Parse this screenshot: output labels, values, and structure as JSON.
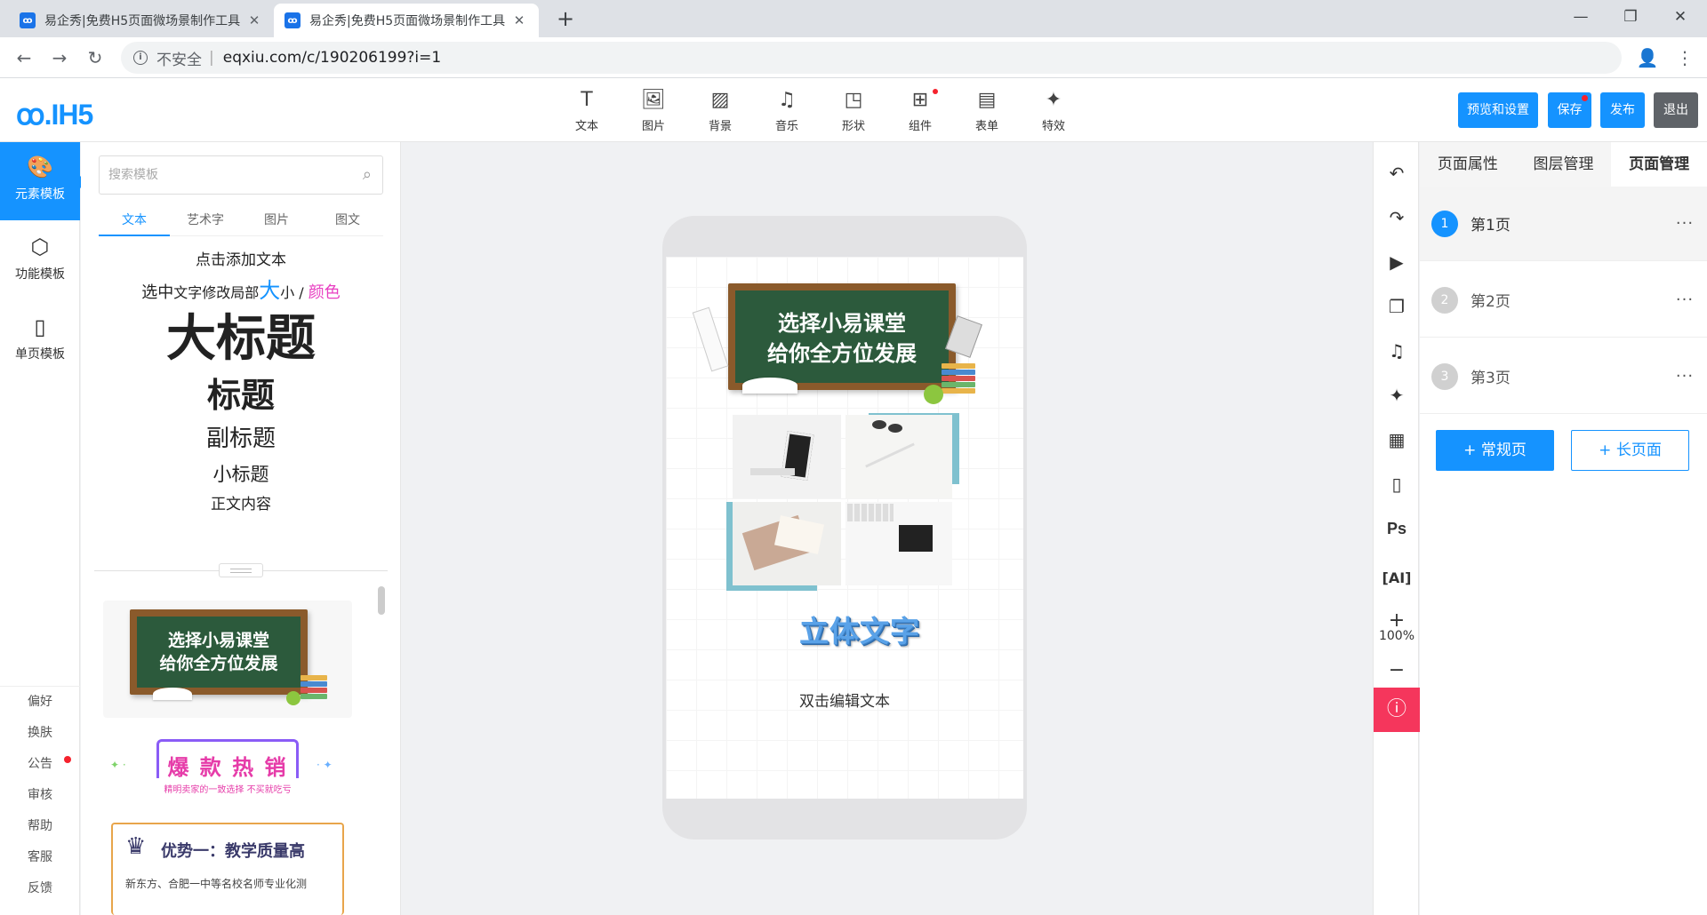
{
  "browser": {
    "tabs": [
      {
        "title": "易企秀|免费H5页面微场景制作工具"
      },
      {
        "title": "易企秀|免费H5页面微场景制作工具"
      }
    ],
    "address": {
      "security_text": "不安全",
      "url": "eqxiu.com/c/190206199?i=1"
    }
  },
  "app": {
    "logo": "ꝏ.IH5",
    "tools": [
      "文本",
      "图片",
      "背景",
      "音乐",
      "形状",
      "组件",
      "表单",
      "特效"
    ],
    "buttons": {
      "preview": "预览和设置",
      "save": "保存",
      "publish": "发布",
      "exit": "退出"
    }
  },
  "leftnav": {
    "items": [
      "元素模板",
      "功能模板",
      "单页模板"
    ],
    "bottom": [
      "偏好",
      "换肤",
      "公告",
      "审核",
      "帮助",
      "客服",
      "反馈"
    ]
  },
  "panel": {
    "search_placeholder": "搜索模板",
    "tabs": [
      "文本",
      "艺术字",
      "图片",
      "图文"
    ],
    "text_samples": {
      "add": "点击添加文本",
      "select_prefix": "选中",
      "select_mid": "文字修改局部",
      "select_big": "大",
      "select_small": "小 / ",
      "select_color": "颜色",
      "h1": "大标题",
      "h2": "标题",
      "h3": "副标题",
      "h4": "小标题",
      "body": "正文内容"
    },
    "cards": {
      "board_line1": "选择小易课堂",
      "board_line2": "给你全方位发展",
      "promo_title": "爆 款 热 销",
      "promo_sub": "精明卖家的一致选择 不买就吃亏",
      "edu_title": "优势一：教学质量高",
      "edu_text": "新东方、合肥一中等名校名师专业化测"
    }
  },
  "canvas": {
    "board_line1": "选择小易课堂",
    "board_line2": "给你全方位发展",
    "art_text": "立体文字",
    "edit_text": "双击编辑文本"
  },
  "iconbar": {
    "zoom": "100%"
  },
  "rightpanel": {
    "tabs": [
      "页面属性",
      "图层管理",
      "页面管理"
    ],
    "pages": [
      {
        "num": "1",
        "name": "第1页"
      },
      {
        "num": "2",
        "name": "第2页"
      },
      {
        "num": "3",
        "name": "第3页"
      }
    ],
    "more": "···",
    "add_normal": "+ 常规页",
    "add_long": "+ 长页面"
  },
  "colors": {
    "accent": "#1593ff",
    "alert": "#f5365c",
    "board": "#2c5a3c"
  }
}
